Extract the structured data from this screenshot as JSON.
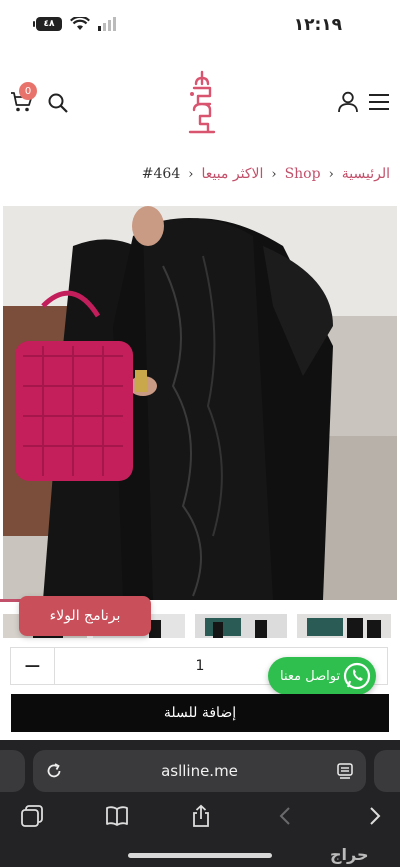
{
  "status_bar": {
    "time": "١٢:١٩",
    "battery": "٤٨"
  },
  "header": {
    "cart_count": "0"
  },
  "breadcrumb": {
    "items": [
      "الرئيسية",
      "Shop",
      "الاكثر مبيعا"
    ],
    "current": "#464",
    "separator": "‹"
  },
  "loyalty": {
    "label": "برنامج الولاء"
  },
  "quantity": {
    "minus": "−",
    "value": "1"
  },
  "whatsapp": {
    "label": "تواصل معنا"
  },
  "add_to_cart": {
    "label": "إضافة للسلة"
  },
  "browser": {
    "url": "aslline.me"
  },
  "watermark": "حراج",
  "colors": {
    "accent": "#c2506a",
    "loyalty": "#c9505a",
    "whatsapp": "#2fbf4f",
    "cta": "#0b0b0b",
    "chrome": "#232325"
  }
}
